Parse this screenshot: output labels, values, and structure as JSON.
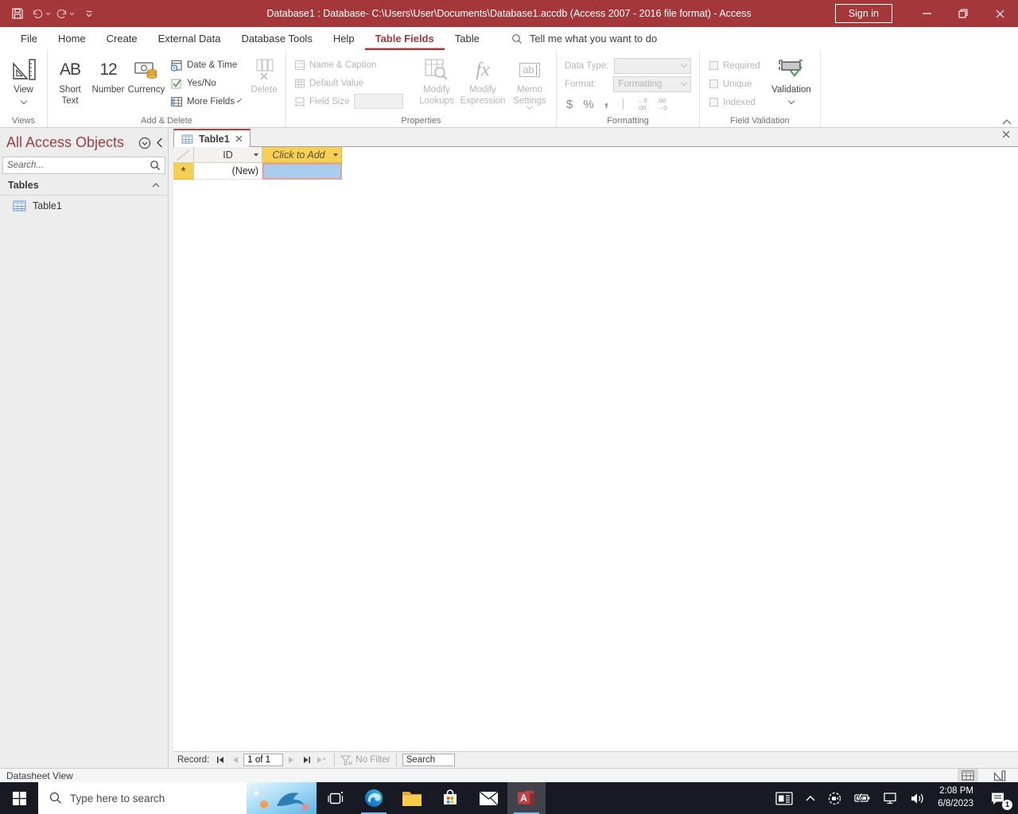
{
  "titlebar": {
    "title": "Database1 : Database- C:\\Users\\User\\Documents\\Database1.accdb (Access 2007 - 2016 file format)  -  Access",
    "sign_in_label": "Sign in"
  },
  "tabs": {
    "items": [
      "File",
      "Home",
      "Create",
      "External Data",
      "Database Tools",
      "Help",
      "Table Fields",
      "Table"
    ],
    "tell_me": "Tell me what you want to do"
  },
  "ribbon": {
    "view_label": "View",
    "views_group": "Views",
    "short_text_glyph": "AB",
    "short_text_label": "Short Text",
    "number_glyph": "12",
    "number_label": "Number",
    "currency_label": "Currency",
    "date_time_label": "Date & Time",
    "yes_no_label": "Yes/No",
    "more_fields_label": "More Fields",
    "delete_label": "Delete",
    "add_delete_group": "Add & Delete",
    "name_caption_label": "Name & Caption",
    "default_value_label": "Default Value",
    "field_size_label": "Field Size",
    "modify_lookups_label": "Modify Lookups",
    "modify_expression_label": "Modify Expression",
    "memo_settings_label": "Memo Settings",
    "fx_glyph": "fx",
    "memo_glyph": "ab",
    "properties_group": "Properties",
    "data_type_label": "Data Type:",
    "format_label": "Format:",
    "format_value": "Formatting",
    "dollar_glyph": "$",
    "percent_glyph": "%",
    "comma_glyph": ",",
    "inc_decimals_glyph": "←0\n.00",
    "dec_decimals_glyph": ".00\n→0",
    "formatting_group": "Formatting",
    "required_label": "Required",
    "unique_label": "Unique",
    "indexed_label": "Indexed",
    "validation_label": "Validation",
    "field_validation_group": "Field Validation"
  },
  "nav": {
    "title": "All Access Objects",
    "search_placeholder": "Search...",
    "tables_group": "Tables",
    "table1": "Table1"
  },
  "doc": {
    "tab_label": "Table1",
    "col_id": "ID",
    "col_add": "Click to Add",
    "new_marker": "*",
    "id_new_value": "(New)"
  },
  "recordnav": {
    "record_label": "Record:",
    "position": "1 of 1",
    "no_filter_label": "No Filter",
    "search_placeholder": "Search"
  },
  "statusbar": {
    "view_name": "Datasheet View"
  },
  "taskbar": {
    "search_placeholder": "Type here to search",
    "time": "2:08 PM",
    "date": "6/8/2023",
    "notification_count": "1"
  },
  "colors": {
    "accent": "#A4373A",
    "gold_header": "#F7CF52",
    "selected_cell_fill": "#AACDEE",
    "selected_cell_border": "#E0A1A1",
    "taskbar_bg": "#171A23"
  }
}
